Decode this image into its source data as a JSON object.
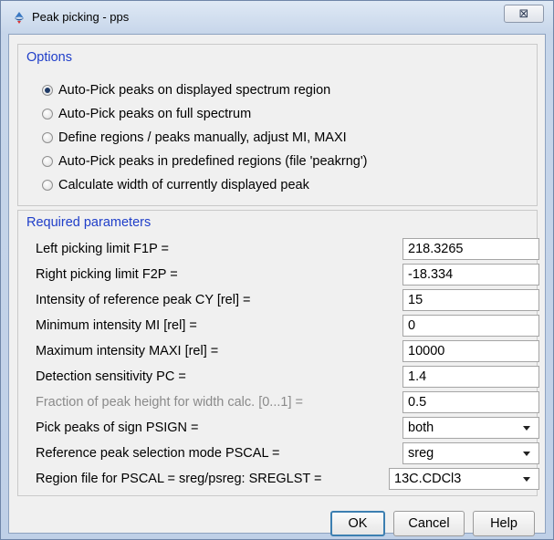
{
  "window": {
    "title": "Peak picking - pps",
    "close_glyph": "⊠"
  },
  "options": {
    "title": "Options",
    "items": [
      {
        "label": "Auto-Pick peaks on displayed spectrum region",
        "checked": true
      },
      {
        "label": "Auto-Pick peaks on full spectrum",
        "checked": false
      },
      {
        "label": "Define regions / peaks manually, adjust MI, MAXI",
        "checked": false
      },
      {
        "label": "Auto-Pick peaks in predefined regions (file 'peakrng')",
        "checked": false
      },
      {
        "label": "Calculate width of currently displayed peak",
        "checked": false
      }
    ]
  },
  "params": {
    "title": "Required parameters",
    "rows": [
      {
        "label": "Left picking limit F1P =",
        "value": "218.3265"
      },
      {
        "label": "Right picking limit F2P =",
        "value": "-18.334"
      },
      {
        "label": "Intensity of reference peak CY [rel] =",
        "value": "15"
      },
      {
        "label": "Minimum intensity MI [rel] =",
        "value": "0"
      },
      {
        "label": "Maximum intensity MAXI [rel] =",
        "value": "10000"
      },
      {
        "label": "Detection sensitivity PC =",
        "value": "1.4"
      },
      {
        "label": "Fraction of peak height for width calc. [0...1] =",
        "value": "0.5"
      },
      {
        "label": "Pick peaks of sign PSIGN =",
        "value": "both"
      },
      {
        "label": "Reference peak selection mode PSCAL =",
        "value": "sreg"
      },
      {
        "label": "Region file for PSCAL = sreg/psreg: SREGLST =",
        "value": "13C.CDCl3"
      }
    ]
  },
  "buttons": {
    "ok": "OK",
    "cancel": "Cancel",
    "help": "Help"
  },
  "colors": {
    "group_title": "#1f3ec9",
    "disabled_text": "#8a8a8a",
    "default_button_border": "#3c7fb1"
  }
}
